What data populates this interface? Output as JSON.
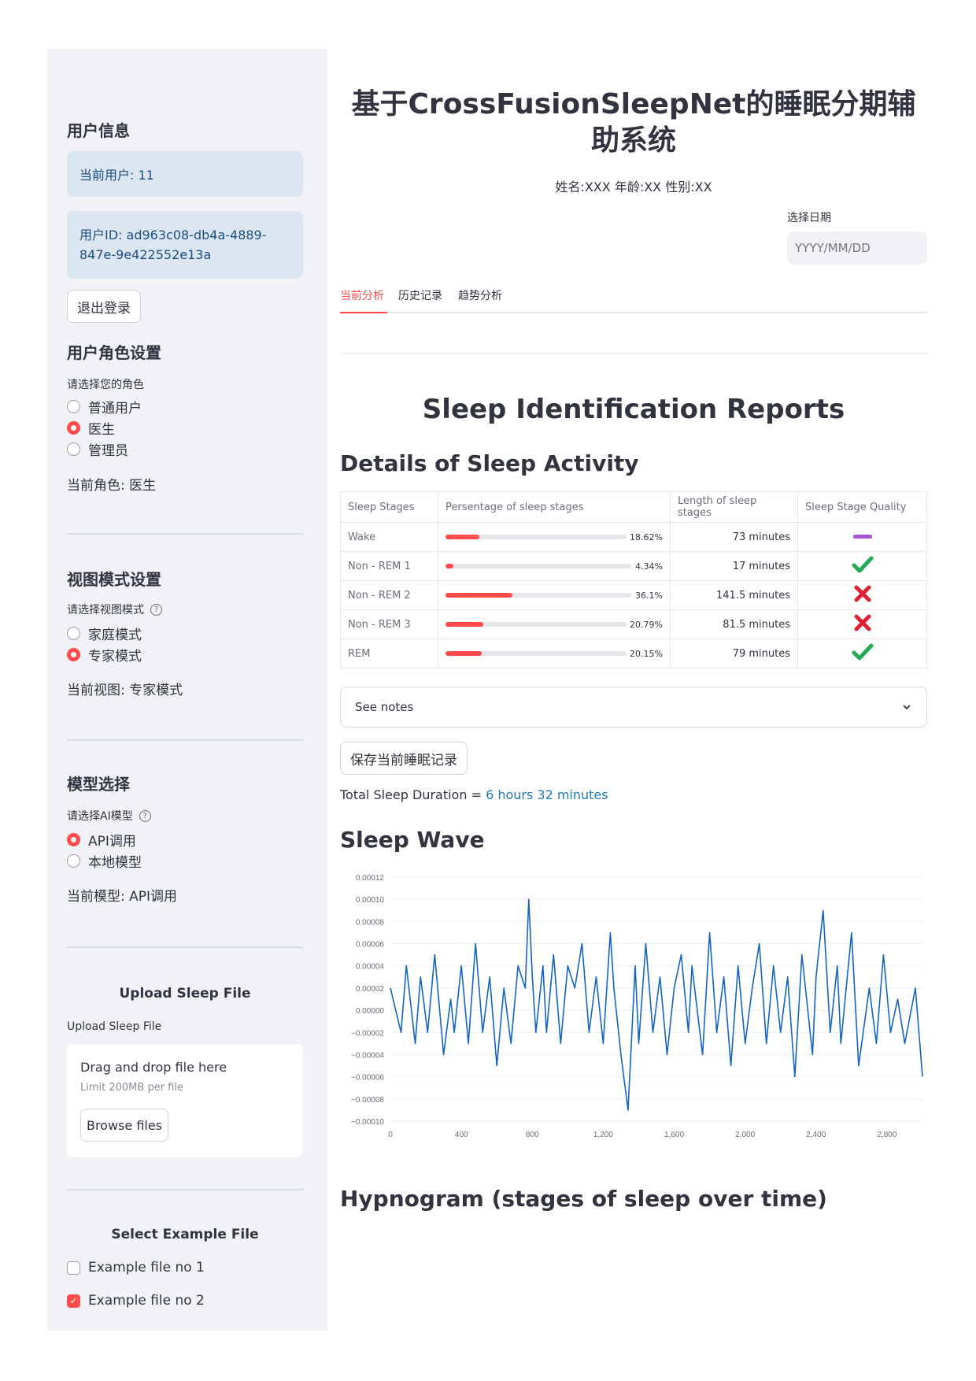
{
  "sidebar": {
    "user_info_title": "用户信息",
    "current_user": "当前用户: 11",
    "user_id": "用户ID: ad963c08-db4a-4889-847e-9e422552e13a",
    "logout_label": "退出登录",
    "role": {
      "title": "用户角色设置",
      "prompt": "请选择您的角色",
      "options": [
        "普通用户",
        "医生",
        "管理员"
      ],
      "selected": "医生",
      "current": "当前角色: 医生"
    },
    "view": {
      "title": "视图模式设置",
      "prompt": "请选择视图模式",
      "options": [
        "家庭模式",
        "专家模式"
      ],
      "selected": "专家模式",
      "current": "当前视图: 专家模式"
    },
    "model": {
      "title": "模型选择",
      "prompt": "请选择AI模型",
      "options": [
        "API调用",
        "本地模型"
      ],
      "selected": "API调用",
      "current": "当前模型: API调用"
    },
    "upload": {
      "title": "Upload Sleep File",
      "label": "Upload Sleep File",
      "drag_text": "Drag and drop file here",
      "limit_text": "Limit 200MB per file",
      "browse_label": "Browse files"
    },
    "examples": {
      "title": "Select Example File",
      "items": [
        {
          "label": "Example file no 1",
          "checked": false
        },
        {
          "label": "Example file no 2",
          "checked": true
        }
      ]
    },
    "accent_color": "#ff4b4b"
  },
  "main": {
    "title": "基于CrossFusionSleepNet的睡眠分期辅助系统",
    "patient_line": "姓名:XXX 年龄:XX 性别:XX",
    "date": {
      "label": "选择日期",
      "placeholder": "YYYY/MM/DD"
    },
    "tabs": [
      "当前分析",
      "历史记录",
      "趋势分析"
    ],
    "active_tab": "当前分析",
    "report_title": "Sleep Identification Reports",
    "details_title": "Details of Sleep Activity",
    "table": {
      "headers": [
        "Sleep Stages",
        "Persentage of sleep stages",
        "Length of sleep stages",
        "Sleep Stage Quality"
      ],
      "rows": [
        {
          "stage": "Wake",
          "pct": 18.62,
          "pct_text": "18.62%",
          "length": "73 minutes",
          "quality": "neutral"
        },
        {
          "stage": "Non - REM 1",
          "pct": 4.34,
          "pct_text": "4.34%",
          "length": "17 minutes",
          "quality": "good"
        },
        {
          "stage": "Non - REM 2",
          "pct": 36.1,
          "pct_text": "36.1%",
          "length": "141.5 minutes",
          "quality": "bad"
        },
        {
          "stage": "Non - REM 3",
          "pct": 20.79,
          "pct_text": "20.79%",
          "length": "81.5 minutes",
          "quality": "bad"
        },
        {
          "stage": "REM",
          "pct": 20.15,
          "pct_text": "20.15%",
          "length": "79 minutes",
          "quality": "good"
        }
      ]
    },
    "notes_label": "See notes",
    "save_label": "保存当前睡眠记录",
    "total_prefix": "Total Sleep Duration = ",
    "total_value": "6 hours 32 minutes",
    "wave_title": "Sleep Wave",
    "hypnogram_title": "Hypnogram (stages of sleep over time)"
  },
  "chart_data": {
    "type": "line",
    "title": "",
    "xlabel": "",
    "ylabel": "",
    "xlim": [
      0,
      3000
    ],
    "ylim": [
      -0.0001,
      0.00012
    ],
    "x_ticks": [
      0,
      400,
      800,
      1200,
      1600,
      2000,
      2400,
      2800
    ],
    "x_tick_labels": [
      "0",
      "400",
      "800",
      "1,200",
      "1,600",
      "2,000",
      "2,400",
      "2,800"
    ],
    "y_ticks": [
      0.00012,
      0.0001,
      8e-05,
      6e-05,
      4e-05,
      2e-05,
      0,
      -2e-05,
      -4e-05,
      -6e-05,
      -8e-05,
      -0.0001
    ],
    "y_tick_labels": [
      "0.00012",
      "0.00010",
      "0.00008",
      "0.00006",
      "0.00004",
      "0.00002",
      "0.00000",
      "−0.00002",
      "−0.00004",
      "−0.00006",
      "−0.00008",
      "−0.00010"
    ],
    "grid": true,
    "color": "#1565c0",
    "series": [
      {
        "x": [
          0,
          60,
          90,
          140,
          170,
          210,
          250,
          300,
          340,
          360,
          400,
          440,
          480,
          520,
          560,
          600,
          640,
          680,
          720,
          760,
          780,
          800,
          820,
          860,
          880,
          920,
          960,
          1000,
          1040,
          1080,
          1120,
          1160,
          1200,
          1240,
          1260,
          1300,
          1340,
          1380,
          1400,
          1440,
          1480,
          1520,
          1560,
          1600,
          1640,
          1680,
          1700,
          1760,
          1800,
          1840,
          1880,
          1920,
          1960,
          2000,
          2040,
          2080,
          2120,
          2160,
          2200,
          2240,
          2280,
          2320,
          2380,
          2400,
          2440,
          2480,
          2520,
          2540,
          2600,
          2640,
          2700,
          2740,
          2780,
          2820,
          2860,
          2900,
          2960,
          3000
        ],
        "y": [
          2e-05,
          -2e-05,
          4e-05,
          -3e-05,
          3e-05,
          -2e-05,
          5e-05,
          -4e-05,
          1e-05,
          -2e-05,
          4e-05,
          -3e-05,
          6e-05,
          -2e-05,
          3e-05,
          -5e-05,
          2e-05,
          -3e-05,
          4e-05,
          2e-05,
          0.0001,
          3e-05,
          -2e-05,
          4e-05,
          -2e-05,
          5e-05,
          -3e-05,
          4e-05,
          2e-05,
          6e-05,
          -2e-05,
          3e-05,
          -3e-05,
          7e-05,
          2e-05,
          -4e-05,
          -9e-05,
          4e-05,
          -3e-05,
          6e-05,
          -2e-05,
          3e-05,
          -4e-05,
          2e-05,
          5e-05,
          -2e-05,
          4e-05,
          -4e-05,
          7e-05,
          -2e-05,
          3e-05,
          -5e-05,
          4e-05,
          -3e-05,
          2e-05,
          6e-05,
          -3e-05,
          4e-05,
          -2e-05,
          3e-05,
          -6e-05,
          5e-05,
          -4e-05,
          3e-05,
          9e-05,
          -2e-05,
          4e-05,
          -3e-05,
          7e-05,
          -5e-05,
          2e-05,
          -3e-05,
          5e-05,
          -2e-05,
          1e-05,
          -3e-05,
          2e-05,
          -6e-05
        ]
      }
    ]
  }
}
